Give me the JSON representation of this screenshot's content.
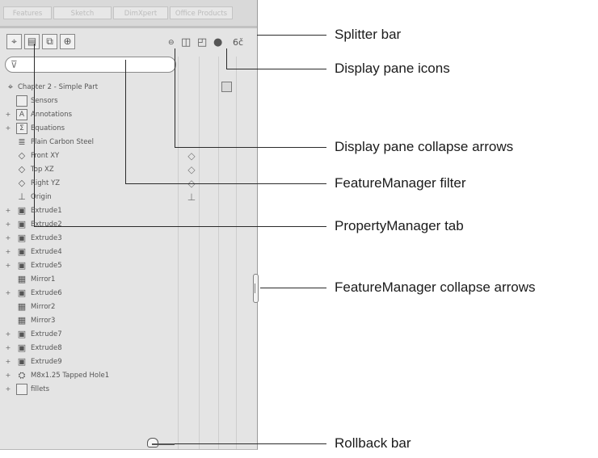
{
  "command_tabs": [
    {
      "label": "Features",
      "active": true
    },
    {
      "label": "Sketch",
      "active": false
    },
    {
      "label": "DimXpert",
      "active": false
    },
    {
      "label": "Office Products",
      "active": false
    }
  ],
  "manager_tabs": [
    {
      "name": "featuremanager-tab",
      "icon": "featuremanager-icon",
      "glyph": "⌖"
    },
    {
      "name": "propertymanager-tab",
      "icon": "propertymanager-icon",
      "glyph": "▤"
    },
    {
      "name": "configurationmanager-tab",
      "icon": "configurationmanager-icon",
      "glyph": "⧉"
    },
    {
      "name": "dimxpertmanager-tab",
      "icon": "dimxpertmanager-icon",
      "glyph": "⊕"
    }
  ],
  "display_pane_icons": [
    {
      "name": "hide-show-icon",
      "glyph": "⊖"
    },
    {
      "name": "display-mode-icon",
      "glyph": "◫"
    },
    {
      "name": "appearance-icon",
      "glyph": "◰"
    },
    {
      "name": "appearance-sphere-icon",
      "glyph": "●"
    },
    {
      "name": "transparency-icon",
      "glyph": "6č"
    }
  ],
  "filter": {
    "icon": "filter-icon",
    "glyph": "⊽",
    "value": ""
  },
  "tree": [
    {
      "label": "Chapter 2 - Simple Part",
      "icon": "part-icon",
      "glyph": "⌖",
      "expander": "",
      "level": 0
    },
    {
      "label": "Sensors",
      "icon": "folder-icon",
      "glyph": "",
      "expander": "",
      "level": 1
    },
    {
      "label": "Annotations",
      "icon": "annotations-icon",
      "glyph": "A",
      "expander": "+",
      "level": 1
    },
    {
      "label": "Equations",
      "icon": "equations-icon",
      "glyph": "Σ",
      "expander": "+",
      "level": 1
    },
    {
      "label": "Plain Carbon Steel",
      "icon": "material-icon",
      "glyph": "≣",
      "expander": "",
      "level": 1
    },
    {
      "label": "Front XY",
      "icon": "plane-icon",
      "glyph": "◇",
      "expander": "",
      "level": 1,
      "display": "◇"
    },
    {
      "label": "Top XZ",
      "icon": "plane-icon",
      "glyph": "◇",
      "expander": "",
      "level": 1,
      "display": "◇"
    },
    {
      "label": "Right YZ",
      "icon": "plane-icon",
      "glyph": "◇",
      "expander": "",
      "level": 1,
      "display": "◇"
    },
    {
      "label": "Origin",
      "icon": "origin-icon",
      "glyph": "⊥",
      "expander": "",
      "level": 1,
      "display": "⊥"
    },
    {
      "label": "Extrude1",
      "icon": "extrude-icon",
      "glyph": "▣",
      "expander": "+",
      "level": 1
    },
    {
      "label": "Extrude2",
      "icon": "extrude-icon",
      "glyph": "▣",
      "expander": "+",
      "level": 1
    },
    {
      "label": "Extrude3",
      "icon": "extrude-icon",
      "glyph": "▣",
      "expander": "+",
      "level": 1
    },
    {
      "label": "Extrude4",
      "icon": "extrude-icon",
      "glyph": "▣",
      "expander": "+",
      "level": 1
    },
    {
      "label": "Extrude5",
      "icon": "extrude-icon",
      "glyph": "▣",
      "expander": "+",
      "level": 1
    },
    {
      "label": "Mirror1",
      "icon": "mirror-icon",
      "glyph": "▦",
      "expander": "",
      "level": 1
    },
    {
      "label": "Extrude6",
      "icon": "extrude-icon",
      "glyph": "▣",
      "expander": "+",
      "level": 1
    },
    {
      "label": "Mirror2",
      "icon": "mirror-icon",
      "glyph": "▦",
      "expander": "",
      "level": 1
    },
    {
      "label": "Mirror3",
      "icon": "mirror-icon",
      "glyph": "▦",
      "expander": "",
      "level": 1
    },
    {
      "label": "Extrude7",
      "icon": "extrude-icon",
      "glyph": "▣",
      "expander": "+",
      "level": 1
    },
    {
      "label": "Extrude8",
      "icon": "extrude-icon",
      "glyph": "▣",
      "expander": "+",
      "level": 1
    },
    {
      "label": "Extrude9",
      "icon": "extrude-icon",
      "glyph": "▣",
      "expander": "+",
      "level": 1
    },
    {
      "label": "M8x1.25 Tapped Hole1",
      "icon": "hole-wizard-icon",
      "glyph": "⛭",
      "expander": "+",
      "level": 1
    },
    {
      "label": "fillets",
      "icon": "folder-icon",
      "glyph": "",
      "expander": "+",
      "level": 1
    }
  ],
  "callouts": [
    {
      "label": "Splitter bar"
    },
    {
      "label": "Display pane icons"
    },
    {
      "label": "Display pane collapse arrows"
    },
    {
      "label": "FeatureManager filter"
    },
    {
      "label": "PropertyManager tab"
    },
    {
      "label": "FeatureManager collapse arrows"
    },
    {
      "label": "Rollback bar"
    }
  ]
}
